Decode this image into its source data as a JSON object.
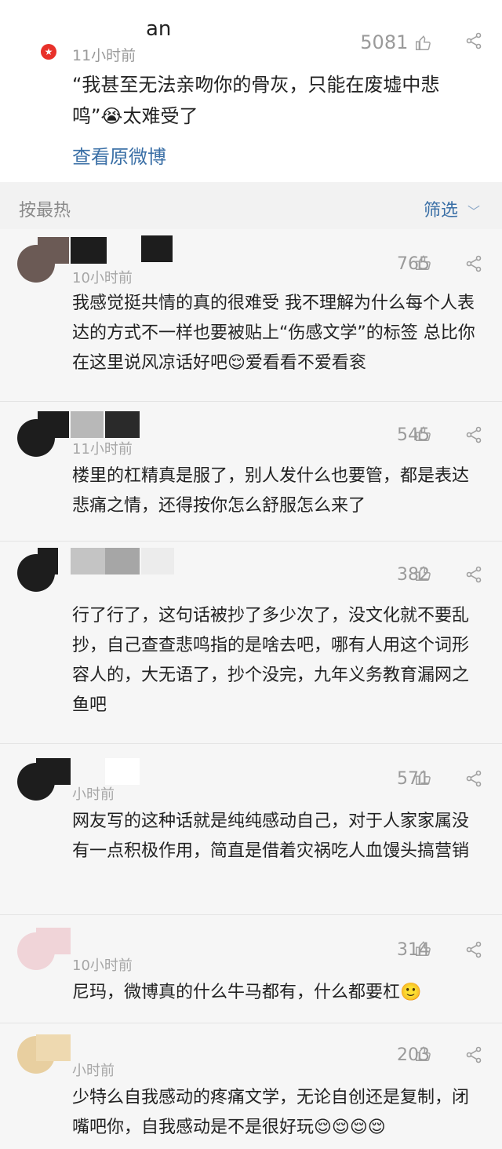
{
  "top_post": {
    "username_visible": "an",
    "badge": "★",
    "time": "11小时前",
    "likes": "5081",
    "text": "“我甚至无法亲吻你的骨灰，只能在废墟中悲鸣”😭太难受了",
    "link": "查看原微博"
  },
  "sortbar": {
    "label": "按最热",
    "filter": "筛选"
  },
  "comments": [
    {
      "time": "10小时前",
      "likes": "765",
      "text": "我感觉挺共情的真的很难受 我不理解为什么每个人表达的方式不一样也要被贴上“伤感文学”的标签 总比你在这里说风凉话好吧😌爱看看不爱看衮"
    },
    {
      "time": "11小时前",
      "likes": "545",
      "text": "楼里的杠精真是服了，别人发什么也要管，都是表达悲痛之情，还得按你怎么舒服怎么来了"
    },
    {
      "time": "",
      "likes": "382",
      "text": "行了行了，这句话被抄了多少次了，没文化就不要乱抄，自己查查悲鸣指的是啥去吧，哪有人用这个词形容人的，大无语了，抄个没完，九年义务教育漏网之鱼吧"
    },
    {
      "time": "小时前",
      "likes": "571",
      "text": "网友写的这种话就是纯纯感动自己，对于人家家属没有一点积极作用，简直是借着灾祸吃人血馒头搞营销"
    },
    {
      "time": "10小时前",
      "likes": "314",
      "text": "尼玛，微博真的什么牛马都有，什么都要杠🙂"
    },
    {
      "time": "小时前",
      "likes": "203",
      "text": "少特么自我感动的疼痛文学，无论自创还是复制，闭嘴吧你，自我感动是不是很好玩😌😌😌😌"
    }
  ],
  "colors": {
    "link": "#3a6fa6",
    "muted": "#9a9a9a",
    "badge": "#e8312a"
  }
}
